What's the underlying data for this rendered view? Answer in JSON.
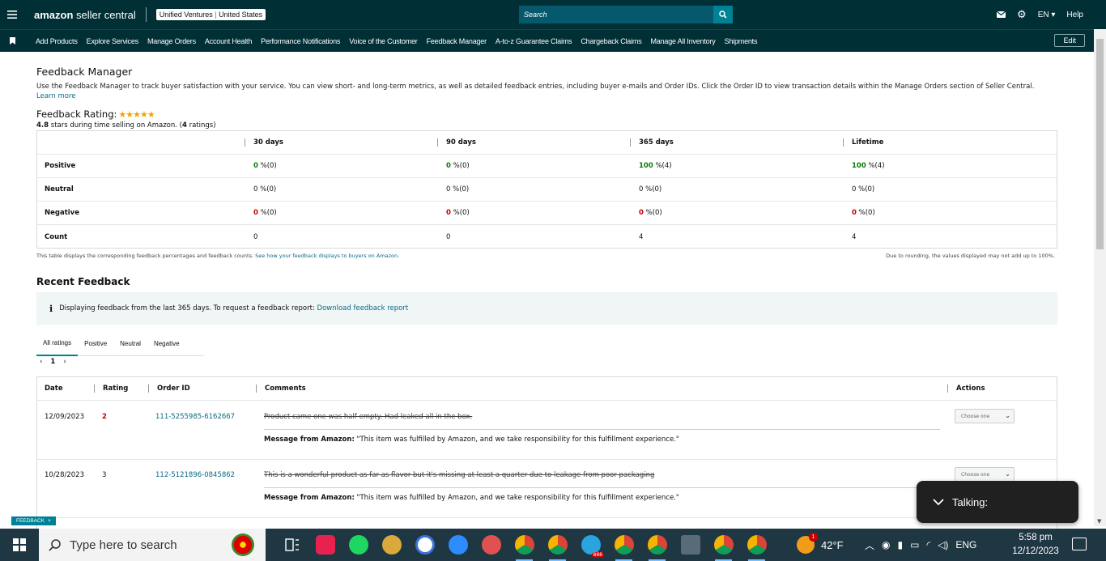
{
  "topbar": {
    "logo_brand": "amazon",
    "logo_product": " seller central",
    "account_name": "Unified Ventures",
    "account_sep": " | ",
    "account_region": "United States",
    "search_placeholder": "Search",
    "lang": "EN",
    "help": "Help"
  },
  "nav": {
    "items": [
      "Add Products",
      "Explore Services",
      "Manage Orders",
      "Account Health",
      "Performance Notifications",
      "Voice of the Customer",
      "Feedback Manager",
      "A-to-z Guarantee Claims",
      "Chargeback Claims",
      "Manage All Inventory",
      "Shipments"
    ],
    "edit": "Edit"
  },
  "page": {
    "title": "Feedback Manager",
    "intro": "Use the Feedback Manager to track buyer satisfaction with your service. You can view short- and long-term metrics, as well as detailed feedback entries, including buyer e-mails and Order IDs. Click the Order ID to view transaction details within the Manage Orders section of Seller Central.",
    "learn_more": "Learn more",
    "rating_label": "Feedback Rating:",
    "stars": "★★★★★",
    "rating_value": "4.8",
    "rating_text": " stars during time selling on Amazon. (",
    "rating_count": "4",
    "rating_suffix": " ratings)"
  },
  "stats": {
    "headers": [
      "30 days",
      "90 days",
      "365 days",
      "Lifetime"
    ],
    "rows": [
      {
        "label": "Positive",
        "cells": [
          {
            "v": "0",
            "u": " %(0)"
          },
          {
            "v": "0",
            "u": " %(0)"
          },
          {
            "v": "100",
            "u": " %(4)"
          },
          {
            "v": "100",
            "u": " %(4)"
          }
        ]
      },
      {
        "label": "Neutral",
        "cells": [
          {
            "v": "0",
            "u": " %(0)"
          },
          {
            "v": "0",
            "u": " %(0)"
          },
          {
            "v": "0",
            "u": " %(0)"
          },
          {
            "v": "0",
            "u": " %(0)"
          }
        ]
      },
      {
        "label": "Negative",
        "cells": [
          {
            "v": "0",
            "u": " %(0)"
          },
          {
            "v": "0",
            "u": " %(0)"
          },
          {
            "v": "0",
            "u": " %(0)"
          },
          {
            "v": "0",
            "u": " %(0)"
          }
        ]
      },
      {
        "label": "Count",
        "cells": [
          {
            "v": "0",
            "u": ""
          },
          {
            "v": "0",
            "u": ""
          },
          {
            "v": "4",
            "u": ""
          },
          {
            "v": "4",
            "u": ""
          }
        ]
      }
    ],
    "note": "This table displays the corresponding feedback percentages and feedback counts. ",
    "note_link": "See how your feedback displays to buyers on Amazon.",
    "note_right": "Due to rounding, the values displayed may not add up to 100%."
  },
  "recent": {
    "title": "Recent Feedback",
    "info": "Displaying feedback from the last 365 days. To request a feedback report: ",
    "info_link": "Download feedback report",
    "tabs": [
      "All ratings",
      "Positive",
      "Neutral",
      "Negative"
    ],
    "page_prev": "‹",
    "page_num": "1",
    "page_next": "›",
    "headers": {
      "date": "Date",
      "rating": "Rating",
      "order": "Order ID",
      "comments": "Comments",
      "actions": "Actions"
    },
    "rows": [
      {
        "date": "12/09/2023",
        "rating": "2",
        "order": "111-5255985-6162667",
        "comment": "Product came one was half empty. Had leaked all in the box.",
        "msg_label": "Message from Amazon:",
        "msg": " \"This item was fulfilled by Amazon, and we take responsibility for this fulfillment experience.\"",
        "action": "Choose one"
      },
      {
        "date": "10/28/2023",
        "rating": "3",
        "order": "112-5121896-0845862",
        "comment": "This is a wonderful product as far as flavor but it's missing at least a quarter due to leakage from poor packaging",
        "msg_label": "Message from Amazon:",
        "msg": " \"This item was fulfilled by Amazon, and we take responsibility for this fulfillment experience.\"",
        "action": "Choose one"
      }
    ]
  },
  "feedback_tag": "FEEDBACK",
  "feedback_close": "×",
  "talking": "Talking:",
  "taskbar": {
    "search_placeholder": "Type here to search",
    "temp": "42°F",
    "lang": "ENG",
    "time": "5:58 pm",
    "date": "12/12/2023",
    "badge": "1",
    "telegram_badge": "888"
  },
  "colors": {
    "dark": "#002f36",
    "teal": "#008296",
    "green": "#067d00",
    "red": "#c40000",
    "link": "#0a6a85",
    "star": "#f0a500"
  }
}
